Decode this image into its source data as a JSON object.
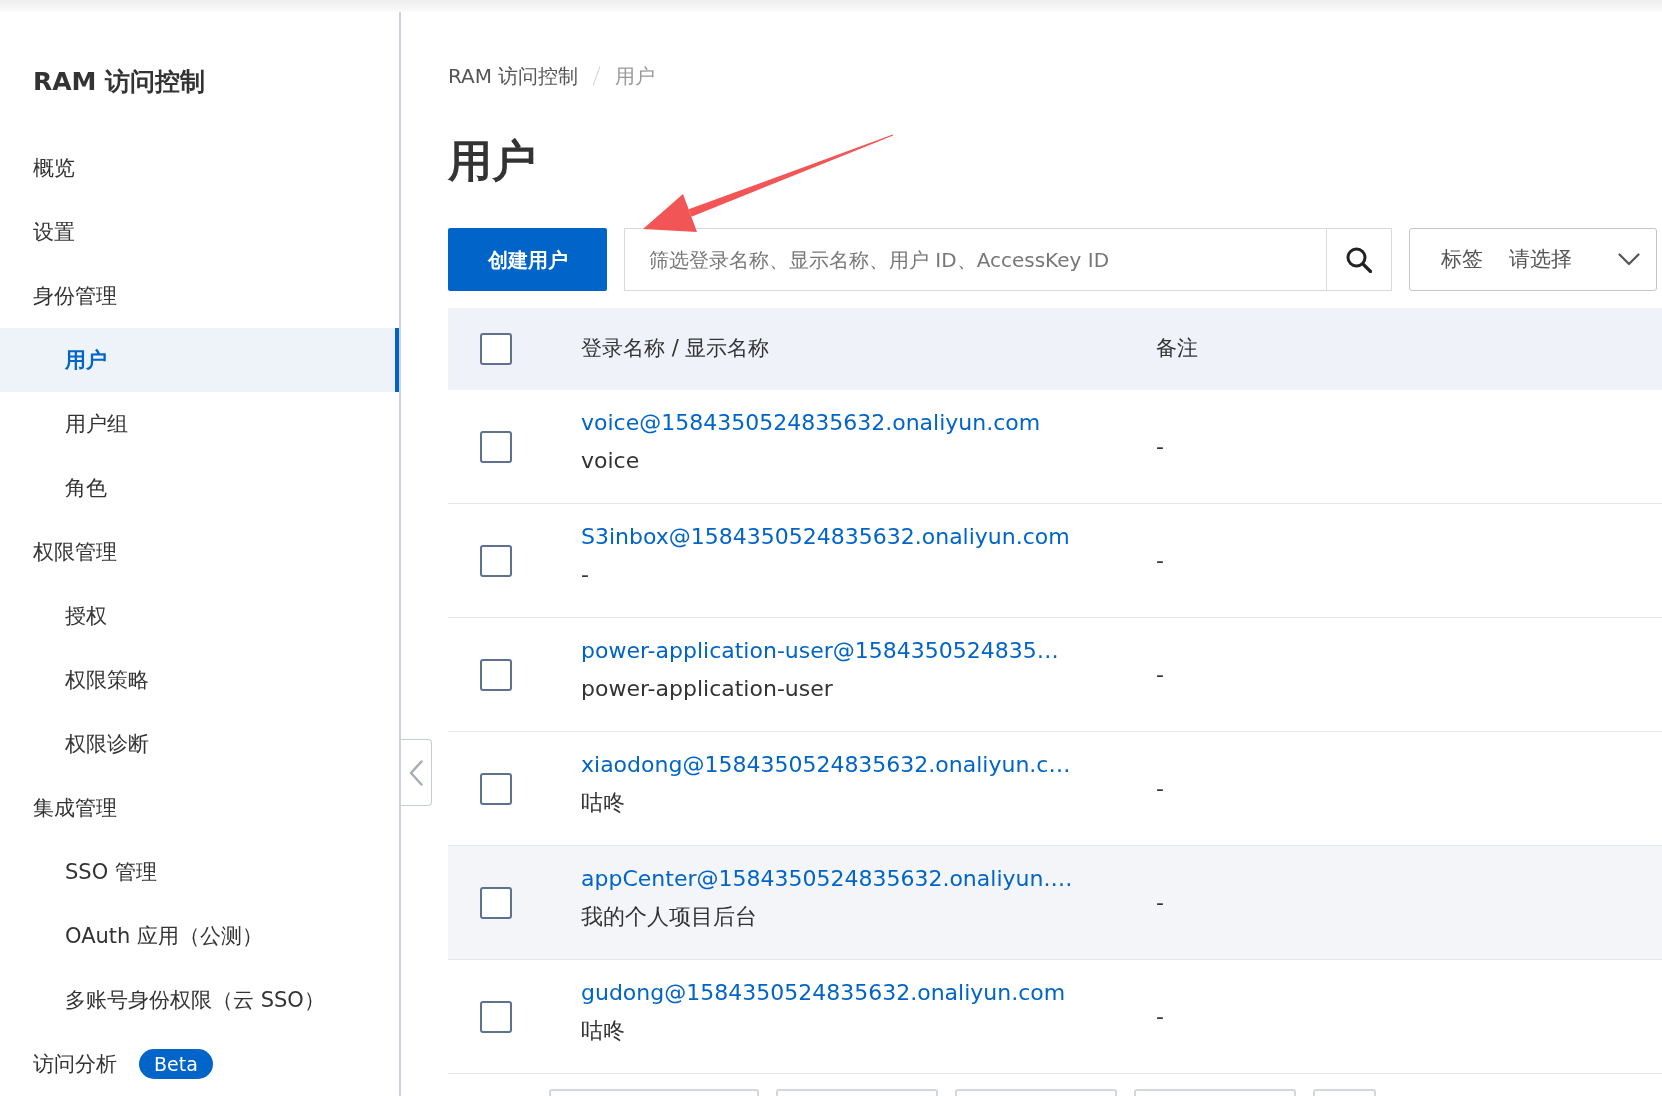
{
  "sidebar": {
    "title": "RAM 访问控制",
    "items": [
      {
        "label": "概览",
        "selected": false
      },
      {
        "label": "设置",
        "selected": false
      },
      {
        "label": "身份管理",
        "selected": false,
        "children": [
          {
            "label": "用户",
            "selected": true
          },
          {
            "label": "用户组",
            "selected": false
          },
          {
            "label": "角色",
            "selected": false
          }
        ]
      },
      {
        "label": "权限管理",
        "selected": false,
        "children": [
          {
            "label": "授权",
            "selected": false
          },
          {
            "label": "权限策略",
            "selected": false
          },
          {
            "label": "权限诊断",
            "selected": false
          }
        ]
      },
      {
        "label": "集成管理",
        "selected": false,
        "children": [
          {
            "label": "SSO 管理",
            "selected": false
          },
          {
            "label": "OAuth 应用（公测）",
            "selected": false
          },
          {
            "label": "多账号身份权限（云 SSO）",
            "selected": false
          }
        ]
      },
      {
        "label": "访问分析",
        "selected": false,
        "badge": "Beta"
      }
    ]
  },
  "breadcrumb": [
    "RAM 访问控制",
    "用户"
  ],
  "page_title": "用户",
  "toolbar": {
    "create_button": "创建用户",
    "search": {
      "placeholder": "筛选登录名称、显示名称、用户 ID、AccessKey ID"
    },
    "tag_filter": {
      "label": "标签",
      "placeholder": "请选择"
    }
  },
  "table": {
    "columns": [
      "登录名称 / 显示名称",
      "备注"
    ],
    "all_checked": false,
    "rows": [
      {
        "login_name": "voice@1584350524835632.onaliyun.com",
        "display_name": "voice",
        "note": "-",
        "checked": false,
        "hovered": false
      },
      {
        "login_name": "S3inbox@1584350524835632.onaliyun.com",
        "display_name": "-",
        "note": "-",
        "checked": false,
        "hovered": false
      },
      {
        "login_name": "power-application-user@1584350524835…",
        "display_name": "power-application-user",
        "note": "-",
        "checked": false,
        "hovered": false
      },
      {
        "login_name": "xiaodong@1584350524835632.onaliyun.c…",
        "display_name": "咕咚",
        "note": "-",
        "checked": false,
        "hovered": false
      },
      {
        "login_name": "appCenter@1584350524835632.onaliyun.…",
        "display_name": "我的个人项目后台",
        "note": "-",
        "checked": false,
        "hovered": true
      },
      {
        "login_name": "gudong@1584350524835632.onaliyun.com",
        "display_name": "咕咚",
        "note": "-",
        "checked": false,
        "hovered": false
      }
    ]
  },
  "footer_buttons": [
    {
      "kind": "wide"
    },
    {
      "kind": "normal"
    },
    {
      "kind": "normal"
    },
    {
      "kind": "normal"
    },
    {
      "kind": "small"
    }
  ]
}
